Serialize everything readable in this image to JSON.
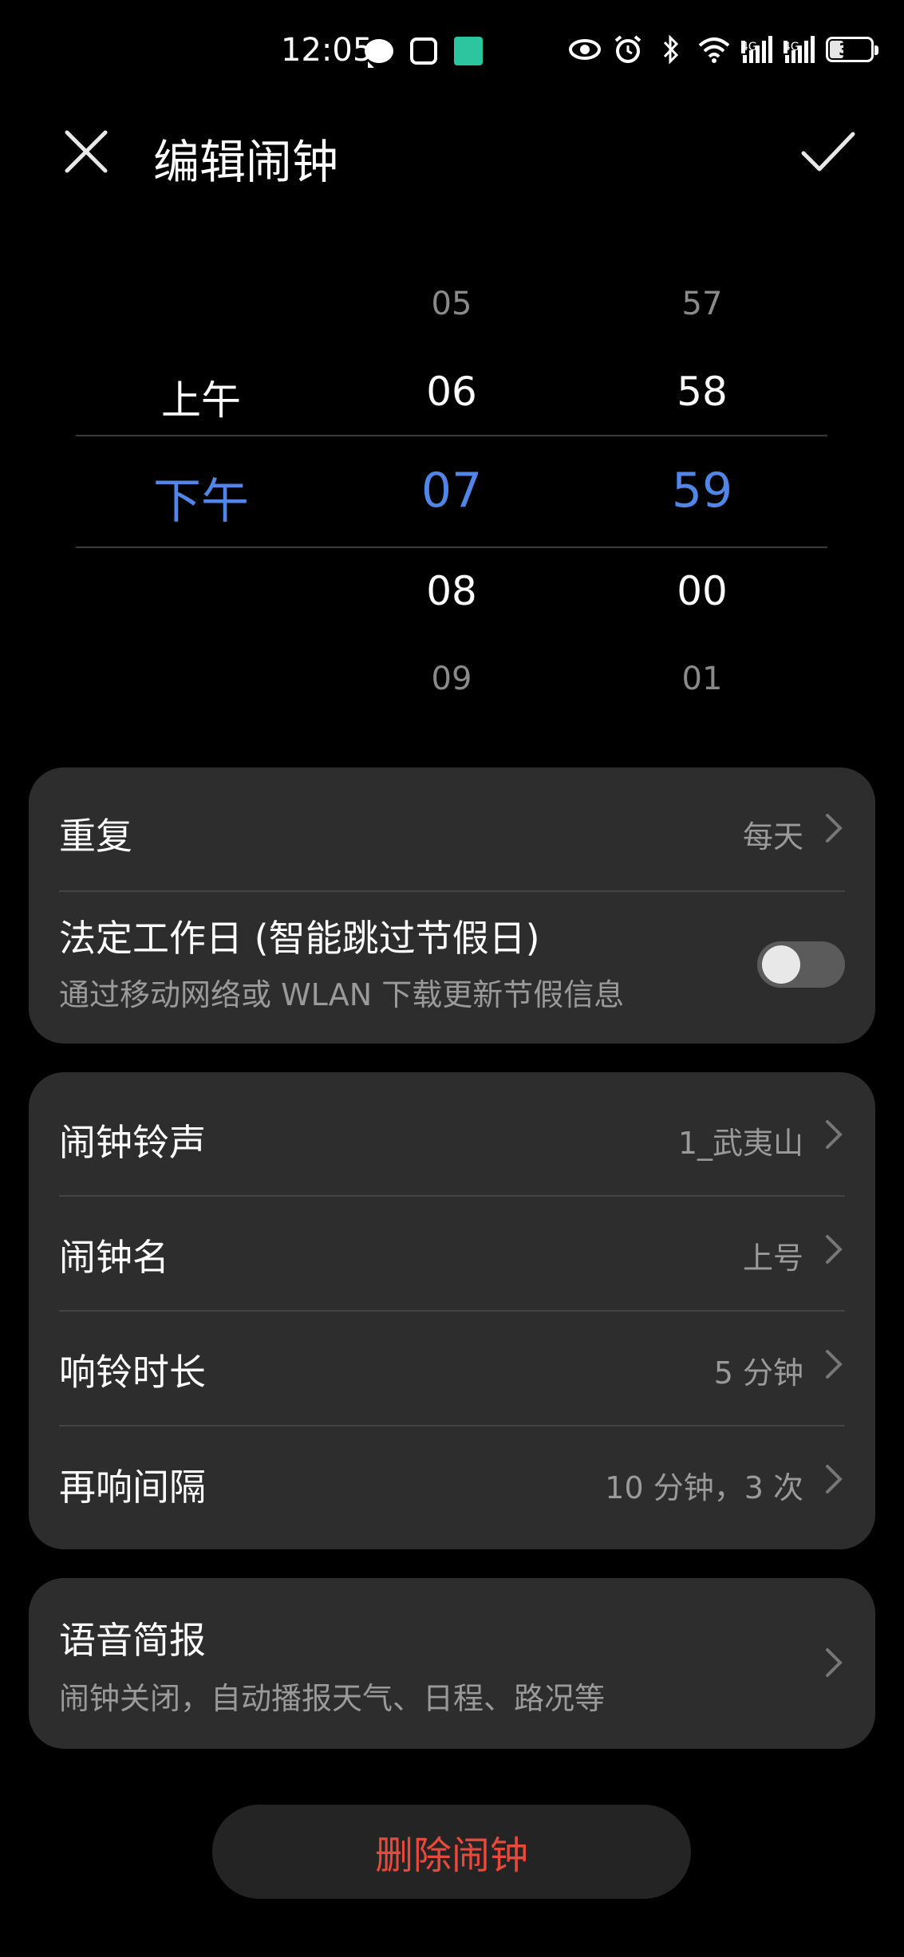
{
  "status_bar": {
    "time": "12:05",
    "left_icons": [
      "message-icon",
      "hand-icon",
      "app-notification-icon"
    ],
    "right_icons": [
      "eye-icon",
      "alarm-icon",
      "bluetooth-icon",
      "wifi-icon",
      "signal-4g-icon",
      "signal-4g-icon",
      "battery-icon"
    ],
    "network_label": "4G",
    "battery_level": "30"
  },
  "header": {
    "title": "编辑闹钟",
    "close_icon": "close-icon",
    "confirm_icon": "check-icon"
  },
  "picker": {
    "ampm": {
      "near_above": "上午",
      "selected": "下午"
    },
    "hour": {
      "far_above": "05",
      "near_above": "06",
      "selected": "07",
      "near_below": "08",
      "far_below": "09"
    },
    "minute": {
      "far_above": "57",
      "near_above": "58",
      "selected": "59",
      "near_below": "00",
      "far_below": "01"
    },
    "selected_color": "#4f86e8"
  },
  "repeat_card": {
    "repeat_label": "重复",
    "repeat_value": "每天",
    "workday_label": "法定工作日 (智能跳过节假日)",
    "workday_sub": "通过移动网络或 WLAN 下载更新节假信息",
    "workday_enabled": false
  },
  "settings_card": {
    "ringtone_label": "闹钟铃声",
    "ringtone_value": "1_武夷山",
    "name_label": "闹钟名",
    "name_value": "上号",
    "duration_label": "响铃时长",
    "duration_value": "5 分钟",
    "snooze_label": "再响间隔",
    "snooze_value": "10 分钟，3 次"
  },
  "voice_card": {
    "label": "语音简报",
    "sub": "闹钟关闭，自动播报天气、日程、路况等"
  },
  "delete_button": {
    "label": "删除闹钟",
    "color": "#e64a3c"
  }
}
